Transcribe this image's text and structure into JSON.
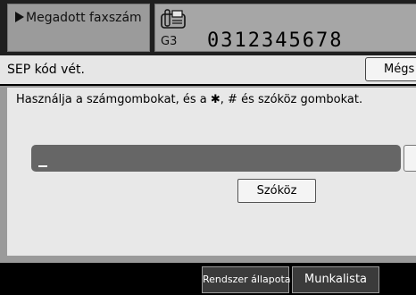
{
  "header": {
    "destination_label": "Megadott faxszám",
    "fax_icon": "fax-machine-icon",
    "mode": "G3",
    "fax_number": "0312345678"
  },
  "dialog": {
    "title": "SEP kód vét.",
    "cancel_label": "Mégs",
    "instruction": "Használja a számgombokat, és a ✱, # és szóköz gombokat.",
    "input_value": "",
    "space_label": "Szóköz"
  },
  "footer": {
    "system_status_label": "Rendszer állapota",
    "job_list_label": "Munkalista"
  },
  "colors": {
    "input_fill": "#666666",
    "panel_gray": "#9a9a9a",
    "footer_button": "#3b3b3b"
  }
}
